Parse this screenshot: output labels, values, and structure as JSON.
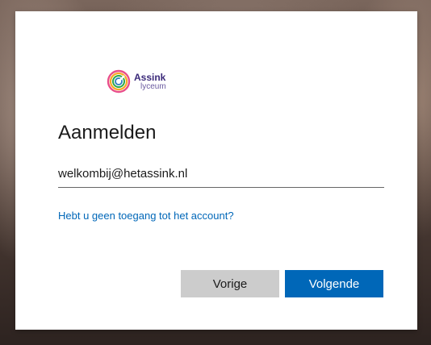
{
  "logo": {
    "name": "Assink",
    "sub": "lyceum"
  },
  "signin": {
    "title": "Aanmelden",
    "email_value": "welkombij@hetassink.nl",
    "no_access_link": "Hebt u geen toegang tot het account?",
    "back_label": "Vorige",
    "next_label": "Volgende"
  },
  "colors": {
    "primary": "#0067b8",
    "secondary_button": "#cccccc",
    "link": "#0067b8"
  }
}
